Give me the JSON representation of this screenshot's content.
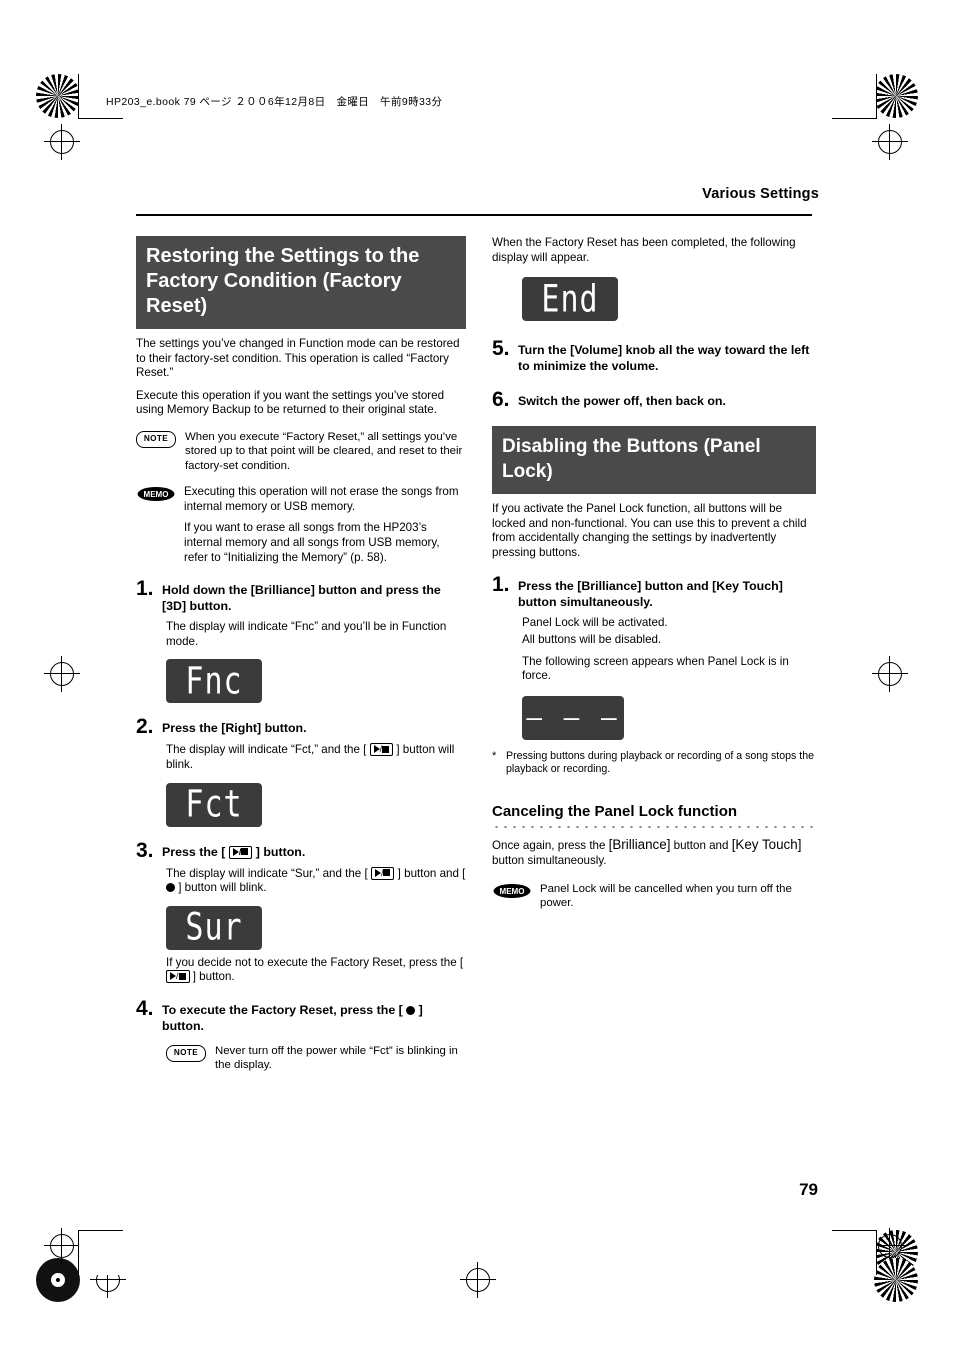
{
  "header": {
    "book_line": "HP203_e.book 79 ページ ２００6年12月8日　金曜日　午前9時33分",
    "running_head": "Various Settings",
    "page_number": "79"
  },
  "left_column": {
    "title": "Restoring the Settings to the Factory Condition (Factory Reset)",
    "intro1": "The settings you’ve changed in Function mode can be restored to their factory-set condition. This operation is called “Factory Reset.”",
    "intro2": "Execute this operation if you want the settings you’ve stored using Memory Backup to be returned to their original state.",
    "note1_label": "NOTE",
    "note1_text": "When you execute “Factory Reset,” all settings you’ve stored up to that point will be cleared, and reset to their factory-set condition.",
    "memo1_label": "MEMO",
    "memo1_text1": "Executing this operation will not erase the songs from internal memory or USB memory.",
    "memo1_text2": "If you want to erase all songs from the HP203’s internal memory and all songs from USB memory, refer to “Initializing the Memory” (p. 58).",
    "steps": [
      {
        "num": "1.",
        "title": "Hold down the [Brilliance] button and press the [3D] button.",
        "body": "The display will indicate “Fnc” and you’ll be in Function mode.",
        "led": "Fnc"
      },
      {
        "num": "2.",
        "title": "Press the [Right] button.",
        "body_pre": "The display will indicate “Fct,” and the [ ",
        "body_post": " ] button will blink.",
        "led": "Fct"
      },
      {
        "num": "3.",
        "title_pre": "Press the [ ",
        "title_post": " ] button.",
        "body_pre": "The display will indicate “Sur,” and the [ ",
        "body_mid": " ] button and [ ",
        "body_post": " ] button will blink.",
        "led": "Sur",
        "after_pre": "If you decide not to execute the Factory Reset, press the [ ",
        "after_post": " ] button."
      },
      {
        "num": "4.",
        "title_pre": "To execute the Factory Reset, press the [ ",
        "title_post": " ] button.",
        "note_label": "NOTE",
        "note_text": "Never turn off the power while “Fct” is blinking in the display."
      }
    ]
  },
  "right_column": {
    "intro": "When the Factory Reset has been completed, the following display will appear.",
    "led_end": "End",
    "steps": [
      {
        "num": "5.",
        "title": "Turn the [Volume] knob all the way toward the left to minimize the volume."
      },
      {
        "num": "6.",
        "title": "Switch the power off, then back on."
      }
    ],
    "title2": "Disabling the Buttons (Panel Lock)",
    "intro2": "If you activate the Panel Lock function, all buttons will be locked and non-functional. You can use this to prevent a child from accidentally changing the settings by inadvertently pressing buttons.",
    "step1": {
      "num": "1.",
      "title": "Press the [Brilliance] button and [Key Touch] button simultaneously.",
      "body1": "Panel Lock will be activated.",
      "body2": "All buttons will be disabled.",
      "body3": "The following screen appears when Panel Lock is in force.",
      "led": "– – –"
    },
    "footnote_star": "*",
    "footnote": "Pressing buttons during playback or recording of a song stops the playback or recording.",
    "section2_title": "Canceling the Panel Lock function",
    "cancel_pre": "Once again, press the ",
    "cancel_b1": "[Brilliance]",
    "cancel_mid": " button and ",
    "cancel_b2": "[Key Touch]",
    "cancel_post": " button simultaneously.",
    "memo_label": "MEMO",
    "memo_text": "Panel Lock will be cancelled when you turn off the power."
  }
}
